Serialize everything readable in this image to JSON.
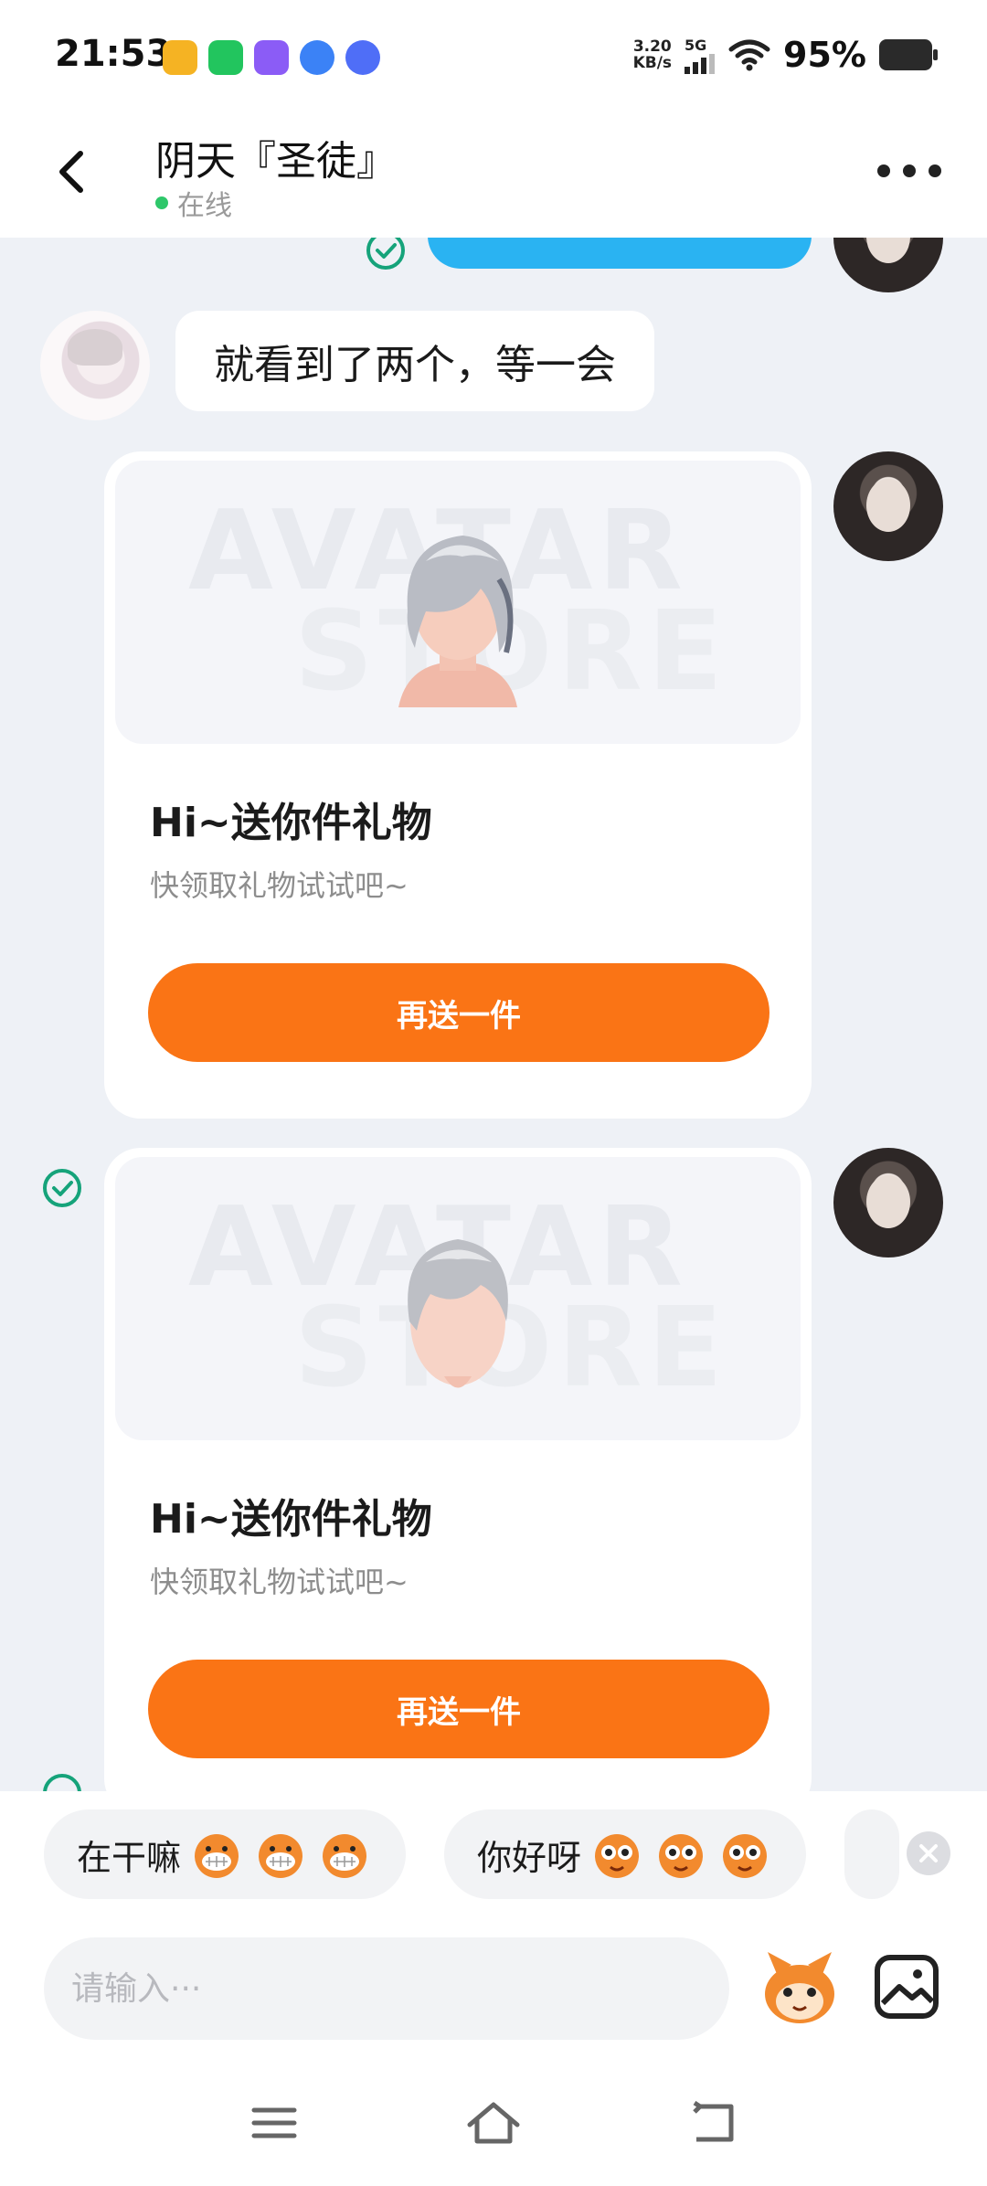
{
  "status_bar": {
    "time": "21:53",
    "net_speed_value": "3.20",
    "net_speed_unit": "KB/s",
    "network": "5G",
    "battery": "95%"
  },
  "header": {
    "name": "阴天『圣徒』",
    "status": "在线"
  },
  "messages": [
    {
      "type": "text",
      "text": "就看到了两个，等一会"
    },
    {
      "type": "gift",
      "title": "Hi~送你件礼物",
      "desc": "快领取礼物试试吧~",
      "button": "再送一件",
      "watermark_top": "AVATAR",
      "watermark_bottom": "STORE"
    },
    {
      "type": "gift",
      "title": "Hi~送你件礼物",
      "desc": "快领取礼物试试吧~",
      "button": "再送一件",
      "watermark_top": "AVATAR",
      "watermark_bottom": "STORE"
    }
  ],
  "quick_replies": [
    {
      "label": "在干嘛"
    },
    {
      "label": "你好呀"
    }
  ],
  "input": {
    "placeholder": "请输入···"
  },
  "colors": {
    "accent_orange": "#fa7415",
    "bubble_blue": "#2ab3f2",
    "online_green": "#2ec76a",
    "check_green": "#15a37a"
  }
}
